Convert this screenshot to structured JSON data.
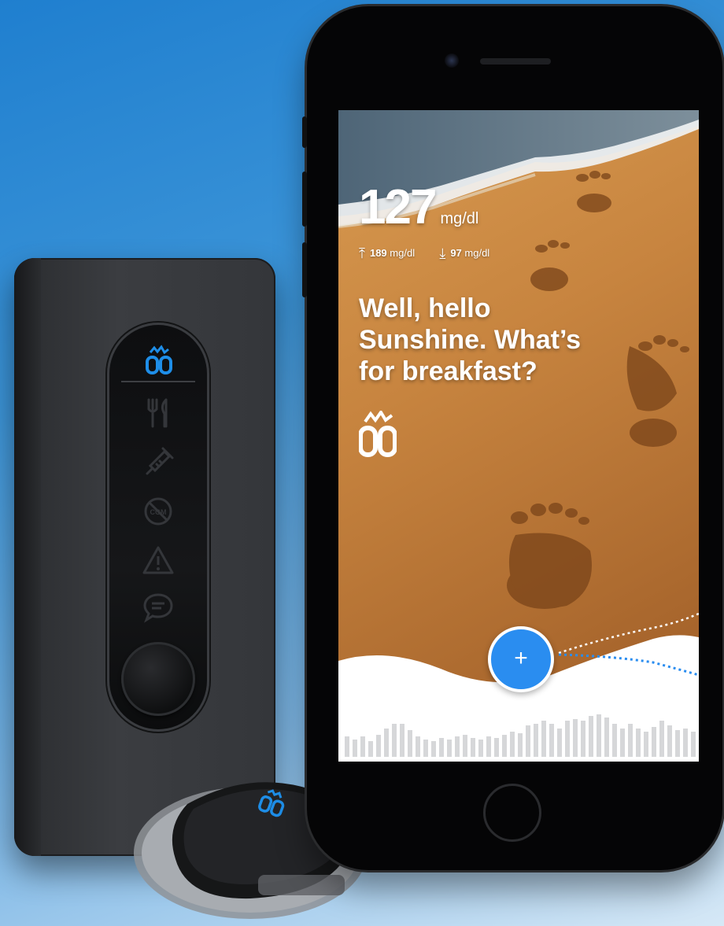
{
  "app": {
    "glucose_value": "127",
    "glucose_unit": "mg/dl",
    "high_value": "189",
    "high_unit": "mg/dl",
    "low_value": "97",
    "low_unit": "mg/dl",
    "greeting": "Well, hello Sunshine. What’s for breakfast?",
    "add_button_label": "+"
  },
  "pump": {
    "icons": [
      "logo-icon",
      "meal-icon",
      "syringe-icon",
      "cgm-off-icon",
      "warning-icon",
      "message-icon"
    ],
    "cgm_text": "CGM"
  },
  "colors": {
    "accent": "#2a8df0",
    "pump_glow": "#1e8ee8",
    "background_top": "#1f7fcf"
  }
}
